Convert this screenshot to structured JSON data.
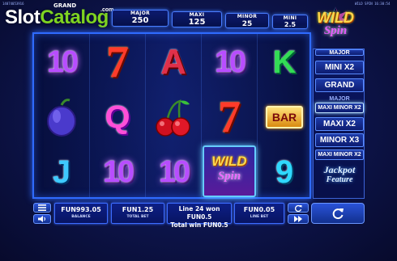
{
  "top_ids": {
    "left": "14074053916",
    "right": "WILD SPIN 16:30:54"
  },
  "watermark": {
    "text_a": "Slot",
    "text_b": "Catalog",
    "com": ".com"
  },
  "jackpots": {
    "grand": {
      "label": "GRAND"
    },
    "major": {
      "label": "MAJOR",
      "value": "250"
    },
    "maxi": {
      "label": "MAXI",
      "value": "125"
    },
    "minor": {
      "label": "MINOR",
      "value": "25"
    },
    "mini": {
      "label": "MINI",
      "value": "2.5"
    }
  },
  "logo": {
    "line1": "WILD",
    "line2": "Spin"
  },
  "reels": [
    [
      "10",
      "plum",
      "J"
    ],
    [
      "7",
      "Q",
      "10"
    ],
    [
      "A",
      "cherry",
      "10"
    ],
    [
      "10",
      "7",
      "wild"
    ],
    [
      "K",
      "BAR",
      "9"
    ]
  ],
  "wild_symbol": {
    "line1": "WILD",
    "line2": "Spin"
  },
  "right_panel": {
    "items": [
      "MAJOR",
      "MINI X2",
      "GRAND",
      "MAJOR",
      "MAXI MINOR X2",
      "MAXI X2",
      "MINOR X3",
      "MAXI MINOR X2"
    ],
    "feature_line1": "Jackpot",
    "feature_line2": "Feature"
  },
  "bottom": {
    "balance_value": "FUN993.05",
    "balance_label": "BALANCE",
    "total_bet_value": "FUN1.25",
    "total_bet_label": "TOTAL BET",
    "win_line1": "Line 24 won FUN0.5",
    "win_line2": "Total win FUN0.5",
    "line_bet_value": "FUN0.05",
    "line_bet_label": "LINE BET"
  },
  "colors": {
    "accent": "#2f6bff",
    "background": "#0e1650",
    "watermark_green": "#7ed321"
  }
}
